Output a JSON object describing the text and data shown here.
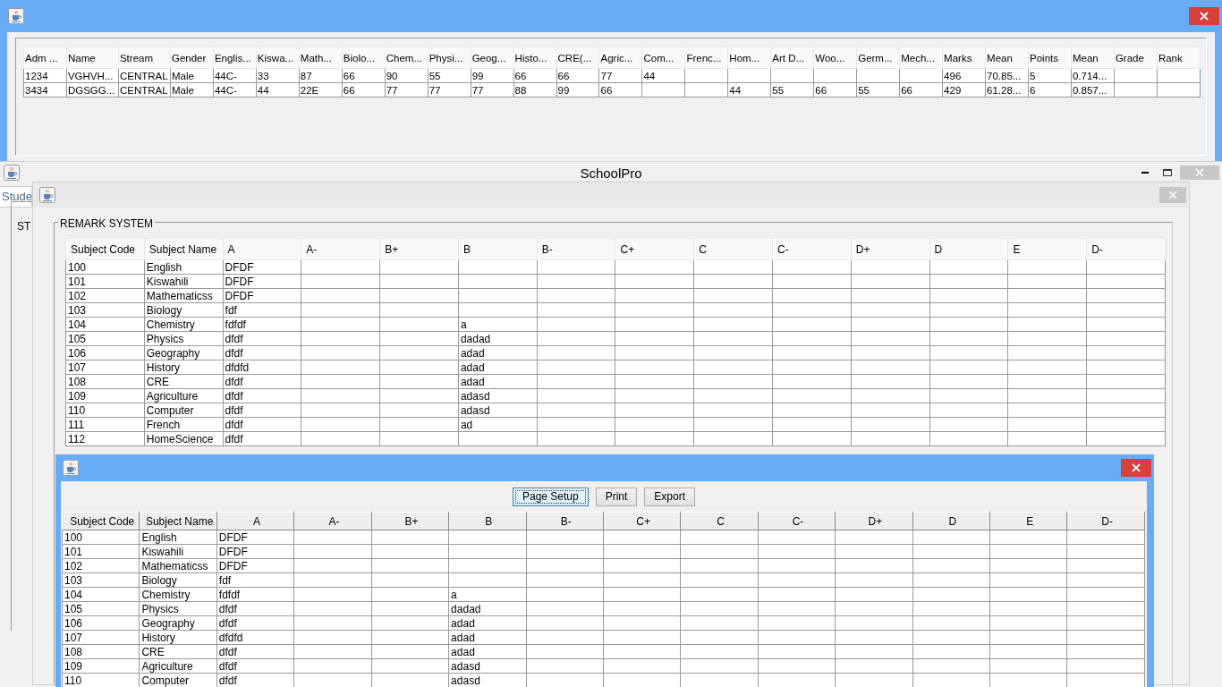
{
  "results_window": {
    "columns": [
      "Adm ...",
      "Name",
      "Stream",
      "Gender",
      "Englis...",
      "Kiswa...",
      "Math...",
      "Biolo...",
      "Chem...",
      "Physi...",
      "Geog...",
      "Histo...",
      "CRE(...",
      "Agric...",
      "Com...",
      "Frenc...",
      "Hom...",
      "Art D...",
      "Woo...",
      "Germ...",
      "Mech...",
      "Marks",
      "Mean",
      "Points",
      "Mean",
      "Grade",
      "Rank"
    ],
    "rows": [
      [
        "1234",
        "VGHVH...",
        "CENTRAL",
        "Male",
        "44C-",
        "33",
        "87",
        "66",
        "90",
        "55",
        "99",
        "66",
        "66",
        "77",
        "44",
        null,
        null,
        null,
        null,
        null,
        null,
        "496",
        "70.85...",
        "5",
        "0.714...",
        null,
        null
      ],
      [
        "3434",
        "DGSGG...",
        "CENTRAL",
        "Male",
        "44C-",
        "44",
        "22E",
        "66",
        "77",
        "77",
        "77",
        "88",
        "99",
        "66",
        null,
        null,
        "44",
        "55",
        "66",
        "55",
        "66",
        "429",
        "61.28...",
        "6",
        "0.857...",
        null,
        null
      ]
    ]
  },
  "main_window": {
    "title": "SchoolPro",
    "tab": "Stude",
    "group_title": "ST"
  },
  "remark_window": {
    "group_title": "REMARK SYSTEM",
    "columns": [
      "Subject Code",
      "Subject Name",
      "A",
      "A-",
      "B+",
      "B",
      "B-",
      "C+",
      "C",
      "C-",
      "D+",
      "D",
      "E",
      "D-"
    ],
    "rows": [
      [
        "100",
        "English",
        "DFDF",
        null,
        null,
        null,
        null,
        null,
        null,
        null,
        null,
        null,
        null,
        null
      ],
      [
        "101",
        "Kiswahili",
        "DFDF",
        null,
        null,
        null,
        null,
        null,
        null,
        null,
        null,
        null,
        null,
        null
      ],
      [
        "102",
        "Mathematicss",
        "DFDF",
        null,
        null,
        null,
        null,
        null,
        null,
        null,
        null,
        null,
        null,
        null
      ],
      [
        "103",
        "Biology",
        "fdf",
        null,
        null,
        null,
        null,
        null,
        null,
        null,
        null,
        null,
        null,
        null
      ],
      [
        "104",
        "Chemistry",
        "fdfdf",
        null,
        null,
        "a",
        null,
        null,
        null,
        null,
        null,
        null,
        null,
        null
      ],
      [
        "105",
        "Physics",
        "dfdf",
        null,
        null,
        "dadad",
        null,
        null,
        null,
        null,
        null,
        null,
        null,
        null
      ],
      [
        "106",
        "Geography",
        "dfdf",
        null,
        null,
        "adad",
        null,
        null,
        null,
        null,
        null,
        null,
        null,
        null
      ],
      [
        "107",
        "History",
        "dfdfd",
        null,
        null,
        "adad",
        null,
        null,
        null,
        null,
        null,
        null,
        null,
        null
      ],
      [
        "108",
        "CRE",
        "dfdf",
        null,
        null,
        "adad",
        null,
        null,
        null,
        null,
        null,
        null,
        null,
        null
      ],
      [
        "109",
        "Agriculture",
        "dfdf",
        null,
        null,
        "adasd",
        null,
        null,
        null,
        null,
        null,
        null,
        null,
        null
      ],
      [
        "110",
        "Computer",
        "dfdf",
        null,
        null,
        "adasd",
        null,
        null,
        null,
        null,
        null,
        null,
        null,
        null
      ],
      [
        "111",
        "French",
        "dfdf",
        null,
        null,
        "ad",
        null,
        null,
        null,
        null,
        null,
        null,
        null,
        null
      ],
      [
        "112",
        "HomeScience",
        "dfdf",
        null,
        null,
        null,
        null,
        null,
        null,
        null,
        null,
        null,
        null,
        null
      ]
    ]
  },
  "preview_window": {
    "buttons": [
      {
        "label": "Page Setup",
        "focused": true
      },
      {
        "label": "Print",
        "focused": false
      },
      {
        "label": "Export",
        "focused": false
      }
    ],
    "columns": [
      "Subject Code",
      "Subject Name",
      "A",
      "A-",
      "B+",
      "B",
      "B-",
      "C+",
      "C",
      "C-",
      "D+",
      "D",
      "E",
      "D-"
    ],
    "rows": [
      [
        "100",
        "English",
        "DFDF",
        null,
        null,
        null,
        null,
        null,
        null,
        null,
        null,
        null,
        null,
        null
      ],
      [
        "101",
        "Kiswahili",
        "DFDF",
        null,
        null,
        null,
        null,
        null,
        null,
        null,
        null,
        null,
        null,
        null
      ],
      [
        "102",
        "Mathematicss",
        "DFDF",
        null,
        null,
        null,
        null,
        null,
        null,
        null,
        null,
        null,
        null,
        null
      ],
      [
        "103",
        "Biology",
        "fdf",
        null,
        null,
        null,
        null,
        null,
        null,
        null,
        null,
        null,
        null,
        null
      ],
      [
        "104",
        "Chemistry",
        "fdfdf",
        null,
        null,
        "a",
        null,
        null,
        null,
        null,
        null,
        null,
        null,
        null
      ],
      [
        "105",
        "Physics",
        "dfdf",
        null,
        null,
        "dadad",
        null,
        null,
        null,
        null,
        null,
        null,
        null,
        null
      ],
      [
        "106",
        "Geography",
        "dfdf",
        null,
        null,
        "adad",
        null,
        null,
        null,
        null,
        null,
        null,
        null,
        null
      ],
      [
        "107",
        "History",
        "dfdfd",
        null,
        null,
        "adad",
        null,
        null,
        null,
        null,
        null,
        null,
        null,
        null
      ],
      [
        "108",
        "CRE",
        "dfdf",
        null,
        null,
        "adad",
        null,
        null,
        null,
        null,
        null,
        null,
        null,
        null
      ],
      [
        "109",
        "Agriculture",
        "dfdf",
        null,
        null,
        "adasd",
        null,
        null,
        null,
        null,
        null,
        null,
        null,
        null
      ],
      [
        "110",
        "Computer",
        "dfdf",
        null,
        null,
        "adasd",
        null,
        null,
        null,
        null,
        null,
        null,
        null,
        null
      ]
    ]
  }
}
